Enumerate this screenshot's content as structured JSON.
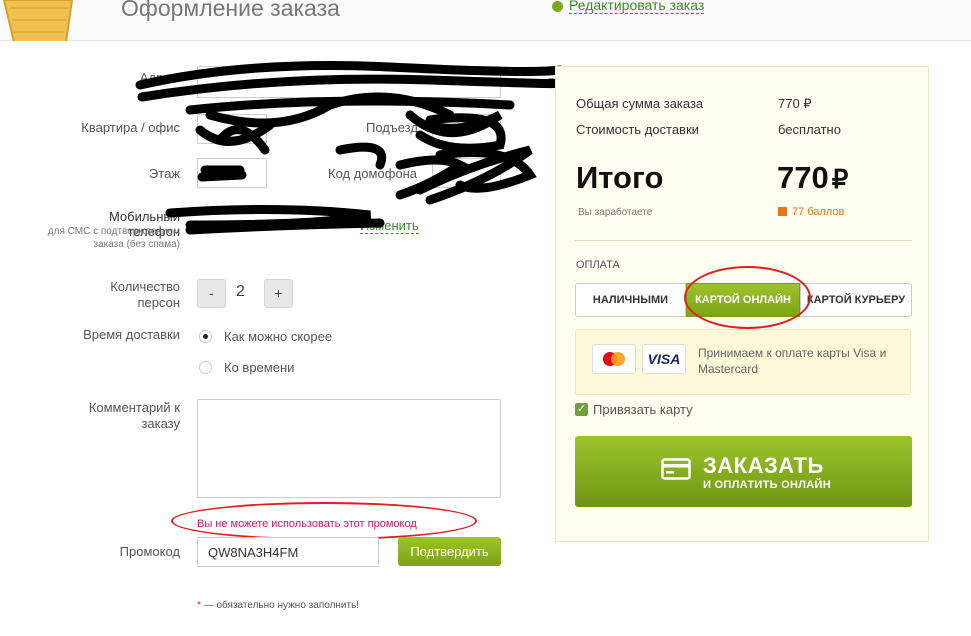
{
  "header": {
    "title": "Оформление заказа",
    "edit_link": "Редактировать заказ"
  },
  "form": {
    "address_label": "Адрес",
    "required_star": "*",
    "apartment_label": "Квартира / офис",
    "entrance_label": "Подъезд",
    "floor_label": "Этаж",
    "intercom_label": "Код домофона",
    "phone_label": "Мобильный телефон",
    "phone_sub": "для СМС с подтверждением заказа (без спама)",
    "change_link": "Изменить",
    "persons_label": "Количество персон",
    "persons_minus": "-",
    "persons_value": "2",
    "persons_plus": "+",
    "delivery_label": "Время доставки",
    "delivery_options": [
      "Как можно скорее",
      "Ко времени"
    ],
    "comment_label": "Комментарий к заказу",
    "promo_error": "Вы не можете использовать этот промокод",
    "promo_label": "Промокод",
    "promo_value": "QW8NA3H4FM",
    "confirm_button": "Подтвердить",
    "required_note": "— обязательно нужно заполнить!"
  },
  "summary": {
    "total_order_label": "Общая сумма заказа",
    "total_order_value": "770 ₽",
    "delivery_cost_label": "Стоимость доставки",
    "delivery_cost_value": "бесплатно",
    "grand_total_label": "Итого",
    "grand_total_value": "770",
    "currency": "₽",
    "earn_label": "Вы заработаете",
    "earn_value": "77 баллов",
    "payment_label": "ОПЛАТА",
    "payment_options": [
      "НАЛИЧНЫМИ",
      "КАРТОЙ ОНЛАЙН",
      "КАРТОЙ КУРЬЕРУ"
    ],
    "card_logos": [
      "mastercard-logo",
      "VISA"
    ],
    "card_note": "Принимаем к оплате карты Visa и Mastercard",
    "bind_card_label": "Привязать карту",
    "order_button_main": "ЗАКАЗАТЬ",
    "order_button_sub": "И ОПЛАТИТЬ ОНЛАЙН"
  },
  "colors": {
    "accent_green": "#8cb520",
    "error": "#d0175a",
    "points_orange": "#e8751a"
  }
}
